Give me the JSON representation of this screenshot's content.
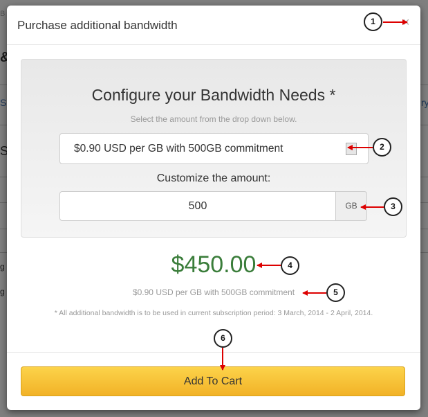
{
  "background": {
    "fragments": [
      "B",
      "&",
      "Su",
      "S",
      "g",
      "g",
      "ry"
    ]
  },
  "modal": {
    "title": "Purchase additional bandwidth",
    "close_glyph": "×"
  },
  "config": {
    "title": "Configure your Bandwidth Needs *",
    "subtitle": "Select the amount from the drop down below.",
    "plan_select": {
      "value": "$0.90 USD per GB with 500GB commitment",
      "arrow_glyph": "▾"
    },
    "customize_label": "Customize the amount:",
    "amount": {
      "value": "500",
      "unit": "GB"
    }
  },
  "summary": {
    "price": "$450.00",
    "price_description": "$0.90 USD per GB with 500GB commitment",
    "note": "* All additional bandwidth is to be used in current subscription period: 3 March, 2014 - 2 April, 2014."
  },
  "footer": {
    "add_to_cart_label": "Add To Cart"
  },
  "callouts": [
    "1",
    "2",
    "3",
    "4",
    "5",
    "6"
  ],
  "colors": {
    "price_green": "#3a7d3a",
    "button_gold": "#f2b227",
    "callout_arrow_red": "#dd0000"
  }
}
